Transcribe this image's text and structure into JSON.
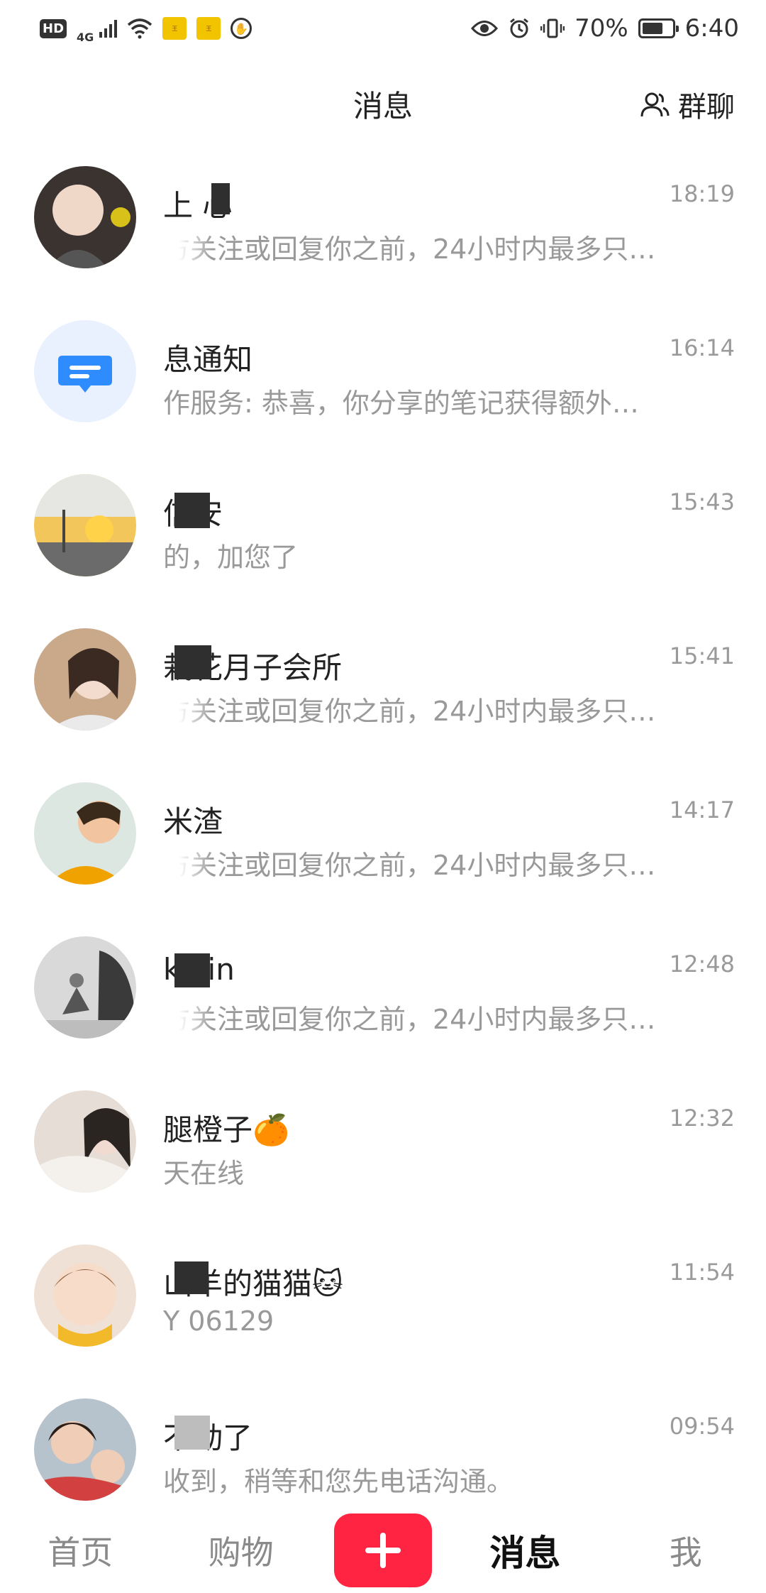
{
  "status_bar": {
    "hd": "HD",
    "network": "4G",
    "app_badge_1": "王",
    "app_badge_2": "王",
    "battery_level": "70%",
    "battery_fraction": 0.7,
    "time": "6:40"
  },
  "header": {
    "title": "消息",
    "group_chat_label": "群聊"
  },
  "chats": [
    {
      "name": "上 心",
      "time": "18:19",
      "preview": "方关注或回复你之前，24小时内最多只…",
      "avatar": {
        "bg": "#3a3330",
        "skin": "#f0d8c8"
      }
    },
    {
      "name": "息通知",
      "time": "16:14",
      "preview": "作服务: 恭喜，你分享的笔记获得额外…",
      "avatar": {
        "bg": "#e9f1ff",
        "icon": "message-icon"
      }
    },
    {
      "name": "信安",
      "time": "15:43",
      "preview": "的，加您了",
      "avatar": {
        "bg": "#f3c65b",
        "skin": "#6b6b6b"
      }
    },
    {
      "name": "栽花月子会所",
      "time": "15:41",
      "preview": "方关注或回复你之前，24小时内最多只…",
      "avatar": {
        "bg": "#c9a98a",
        "skin": "#f3dccd"
      }
    },
    {
      "name": "米渣",
      "time": "14:17",
      "preview": "方关注或回复你之前，24小时内最多只…",
      "avatar": {
        "bg": "#dce7e2",
        "skin": "#f2c5a0"
      }
    },
    {
      "name": "k vin",
      "time": "12:48",
      "preview": "方关注或回复你之前，24小时内最多只…",
      "avatar": {
        "bg": "#d9d9d9",
        "skin": "#777777"
      }
    },
    {
      "name": "腿橙子🍊",
      "time": "12:32",
      "preview": "天在线",
      "avatar": {
        "bg": "#e6ddd6",
        "skin": "#f1dbd0"
      }
    },
    {
      "name": "山羊的猫猫🐱",
      "time": "11:54",
      "preview": "Y 06129",
      "avatar": {
        "bg": "#efe1d6",
        "skin": "#f7dcc9"
      }
    },
    {
      "name": "不动了",
      "time": "09:54",
      "preview": "收到，稍等和您先电话沟通。",
      "avatar": {
        "bg": "#b7c3cc",
        "skin": "#f0cdb6"
      }
    }
  ],
  "bottom_nav": {
    "home": "首页",
    "shop": "购物",
    "messages": "消息",
    "me": "我"
  },
  "colors": {
    "accent": "#ff2442",
    "muted_text": "#999999"
  }
}
